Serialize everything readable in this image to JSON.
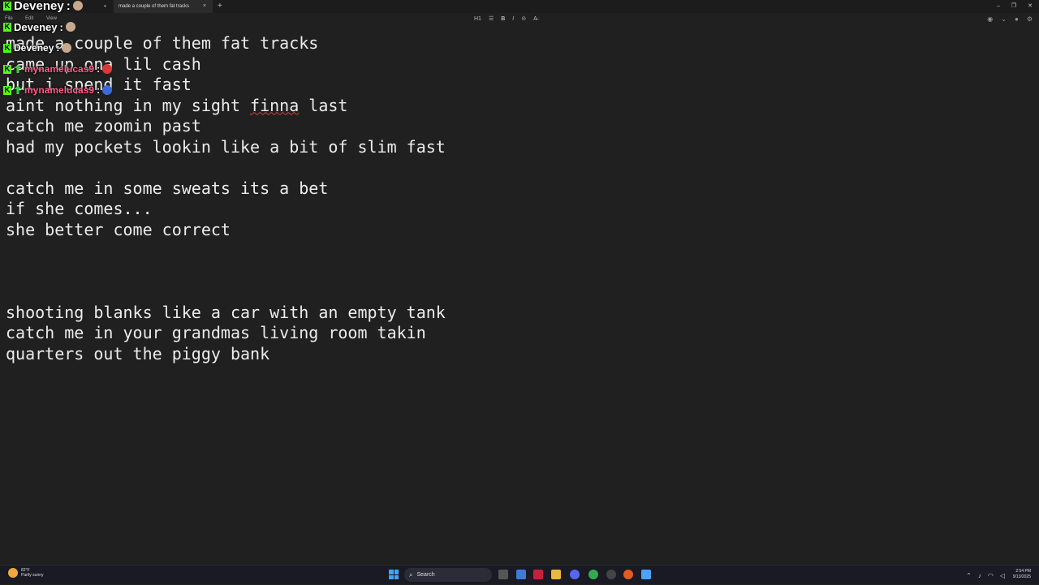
{
  "window": {
    "tab_title": "made a couple of them fat tracks",
    "tab_close": "×",
    "tab_dot": "•",
    "new_tab": "+",
    "controls": [
      "–",
      "❐",
      "✕"
    ]
  },
  "menu": [
    "File",
    "Edit",
    "View"
  ],
  "toolbar": {
    "heading": "H1",
    "list": "☰",
    "bold": "B",
    "italic": "I",
    "link": "⊝",
    "clear": "A̶"
  },
  "editor": {
    "lines": [
      "made a couple of them fat tracks",
      "came up ona lil cash",
      "but i spend it fast",
      "aint nothing in my sight finna last",
      "catch me zoomin past",
      "had my pockets lookin like a bit of slim fast",
      "",
      "catch me in some sweats its a bet",
      "if she comes...",
      "she better come correct",
      "",
      "",
      "",
      "shooting blanks like a car with an empty tank",
      "catch me in your grandmas living room takin",
      "quarters out the piggy bank"
    ]
  },
  "chat": [
    {
      "user": "Deveney",
      "color": "#ffffff",
      "size": 15
    },
    {
      "user": "Deveney",
      "color": "#ffffff",
      "size": 13
    },
    {
      "user": "Deveney",
      "color": "#ffffff",
      "size": 12
    },
    {
      "user": "mynamelucas9",
      "color": "#ff5c8a",
      "size": 12
    },
    {
      "user": "mynamelucas9",
      "color": "#ff5c8a",
      "size": 12
    }
  ],
  "taskbar": {
    "weather_temp": "82°F",
    "weather_desc": "Partly sunny",
    "search_label": "Search",
    "time": "2:54 PM",
    "date": "9/13/2025"
  },
  "colors": {
    "background": "#202020",
    "text": "#ececec",
    "kick_green": "#53fc18",
    "pink_user": "#ff5c8a"
  }
}
